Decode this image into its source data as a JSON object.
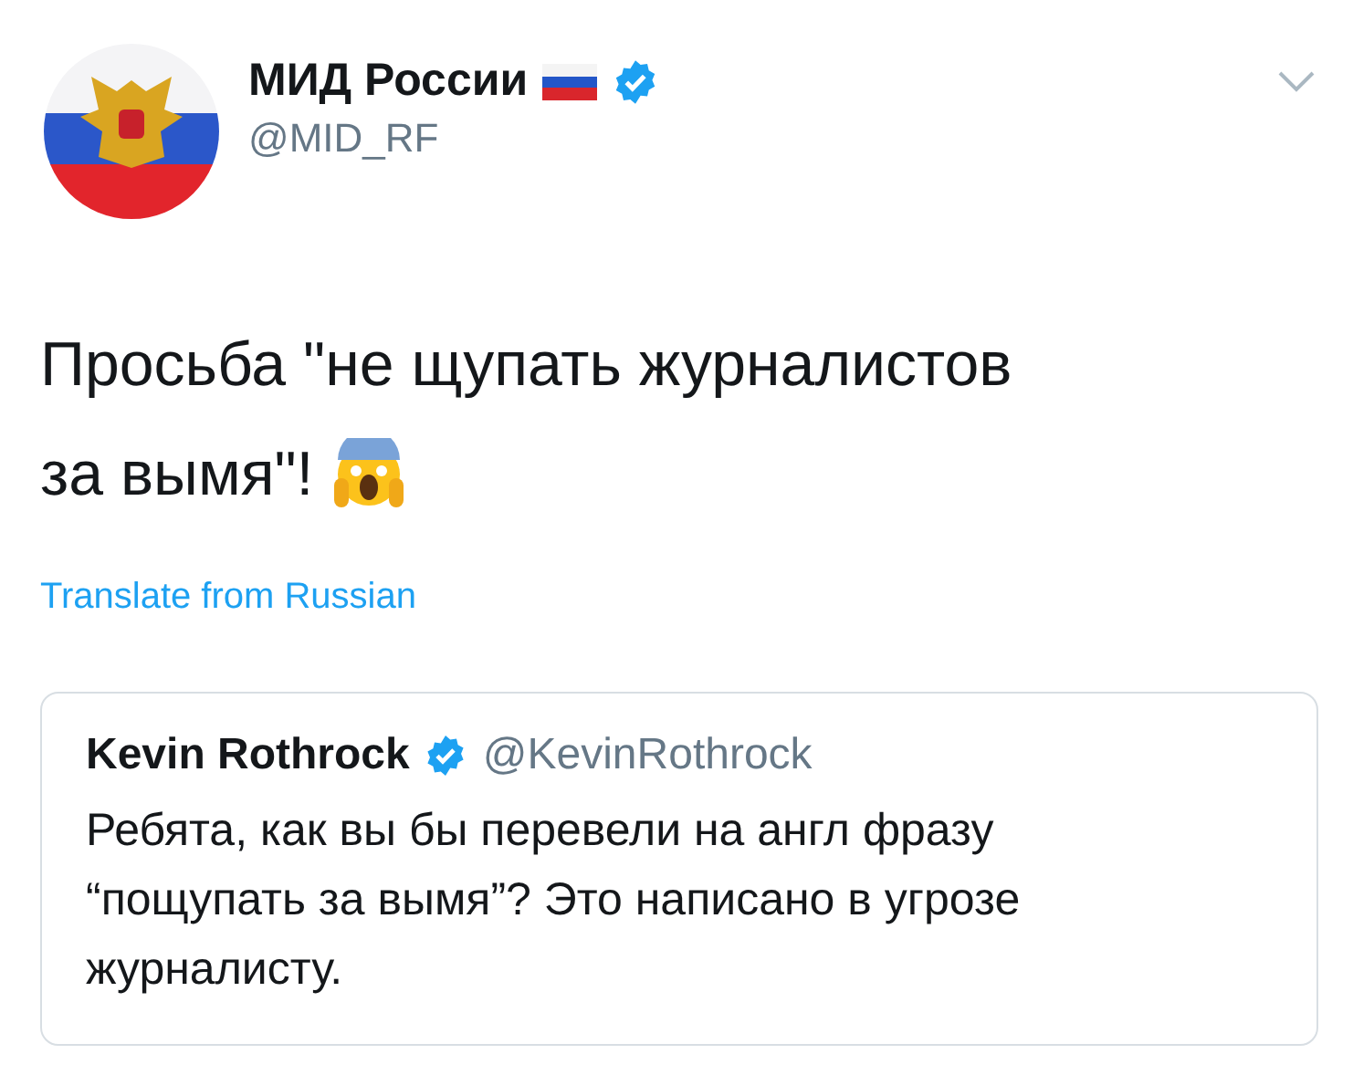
{
  "author": {
    "name": "МИД России",
    "handle": "@MID_RF",
    "verified": true
  },
  "tweet": {
    "lines": [
      "Просьба \"не щупать журналистов",
      "за вымя\"!"
    ]
  },
  "translate_link": "Translate from Russian",
  "quoted_tweet": {
    "name": "Kevin Rothrock",
    "verified": true,
    "handle": "@KevinRothrock",
    "text": "Ребята, как вы бы перевели на англ фразу “пощупать за вымя”? Это написано в угрозе журналисту."
  }
}
